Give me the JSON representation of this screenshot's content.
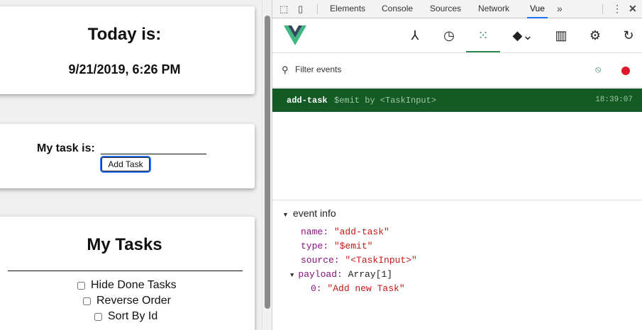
{
  "app": {
    "today_title": "Today is:",
    "datetime": "9/21/2019, 6:26 PM",
    "task_label": "My task is:",
    "task_input_value": "",
    "add_button": "Add Task",
    "tasks_title": "My Tasks",
    "options": [
      "Hide Done Tasks",
      "Reverse Order",
      "Sort By Id"
    ]
  },
  "devtools": {
    "tabs": [
      "Elements",
      "Console",
      "Sources",
      "Network",
      "Vue"
    ],
    "active_tab": "Vue",
    "more_icon": "chevron-double-right-icon",
    "vue_toolbar": {
      "buttons": [
        "components-icon",
        "vuex-history-icon",
        "events-icon",
        "routing-icon",
        "performance-icon",
        "settings-icon",
        "refresh-icon"
      ],
      "active": "events-icon"
    },
    "filter": {
      "placeholder": "Filter events"
    },
    "event": {
      "name": "add-task",
      "type": "$emit by <TaskInput>",
      "time": "18:39:07"
    },
    "event_info": {
      "title": "event info",
      "name_key": "name:",
      "name_val": "\"add-task\"",
      "type_key": "type:",
      "type_val": "\"$emit\"",
      "source_key": "source:",
      "source_val": "\"<TaskInput>\"",
      "payload_key": "payload:",
      "payload_val": "Array[1]",
      "item_key": "0:",
      "item_val": "\"Add new Task\""
    }
  },
  "colors": {
    "vue_green": "#2c8a55",
    "event_row": "#145a24",
    "record": "#e0192a"
  }
}
